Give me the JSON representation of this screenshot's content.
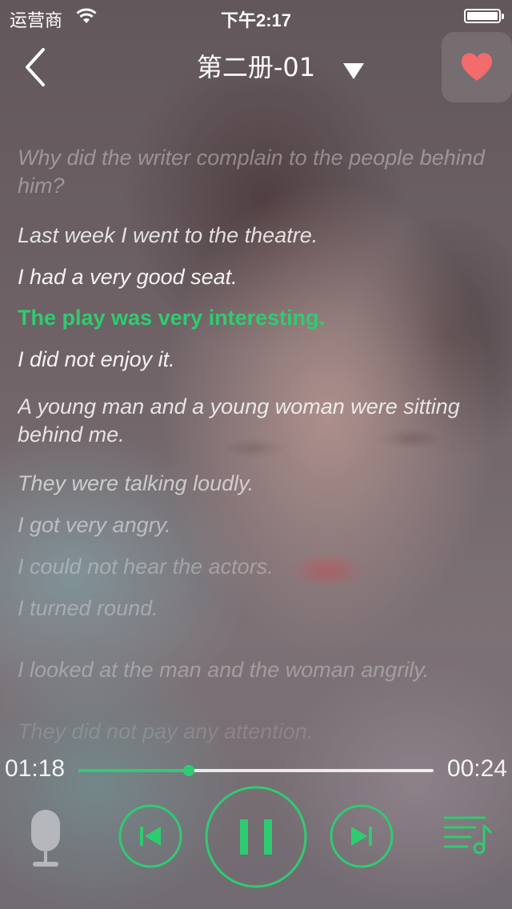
{
  "status_bar": {
    "carrier": "运营商",
    "time": "下午2:17"
  },
  "nav": {
    "title": "第二册-01",
    "back_icon": "chevron-left-icon",
    "dropdown_icon": "triangle-down-icon",
    "favorite_icon": "heart-icon",
    "favorite_color": "#f36b6b"
  },
  "lyrics": {
    "lines": [
      "Why did the writer complain to the people behind him?",
      "Last week I went to the theatre.",
      "I had a very good seat.",
      "The play was very interesting.",
      "I did not enjoy it.",
      "A young man and a young woman were sitting behind me.",
      "They were talking loudly.",
      "I got very angry.",
      "I could not hear the actors.",
      "I turned round.",
      "I looked at the man and the woman angrily.",
      "They did not pay any attention."
    ],
    "active_index": 3,
    "active_color": "#2ecc71"
  },
  "player": {
    "current_time": "01:18",
    "total_time": "00:24",
    "progress_fraction": 0.31,
    "accent_color": "#2ecc71",
    "icons": {
      "mic": "microphone-icon",
      "prev": "skip-previous-icon",
      "play_pause": "pause-icon",
      "next": "skip-next-icon",
      "playlist": "playlist-music-icon"
    }
  }
}
